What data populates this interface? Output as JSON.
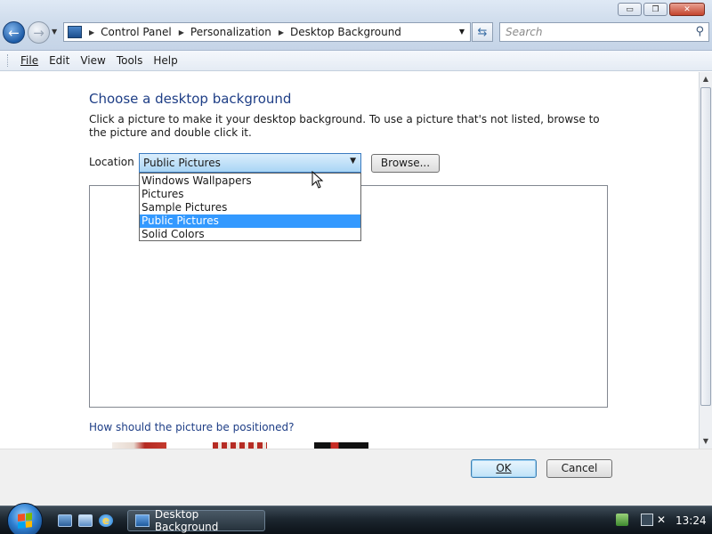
{
  "window": {
    "minimize_glyph": "▭",
    "maximize_glyph": "❐",
    "close_glyph": "✕"
  },
  "nav": {
    "back_glyph": "←",
    "forward_glyph": "→"
  },
  "address": {
    "crumbs": [
      "Control Panel",
      "Personalization",
      "Desktop Background"
    ]
  },
  "search": {
    "placeholder": "Search"
  },
  "menu": {
    "file": "File",
    "edit": "Edit",
    "view": "View",
    "tools": "Tools",
    "help": "Help"
  },
  "page": {
    "heading": "Choose a desktop background",
    "description": "Click a picture to make it your desktop background. To use a picture that's not listed, browse to the picture and double click it.",
    "location_label": "Location",
    "location_value": "Public Pictures",
    "browse_label": "Browse...",
    "position_question": "How should the picture be positioned?"
  },
  "location_options": [
    {
      "label": "Windows Wallpapers",
      "selected": false
    },
    {
      "label": "Pictures",
      "selected": false
    },
    {
      "label": "Sample Pictures",
      "selected": false
    },
    {
      "label": "Public Pictures",
      "selected": true
    },
    {
      "label": "Solid Colors",
      "selected": false
    }
  ],
  "footer": {
    "ok_label": "OK",
    "cancel_label": "Cancel"
  },
  "taskbar": {
    "active_window": "Desktop Background",
    "clock": "13:24"
  },
  "colors": {
    "heading": "#1e3e86",
    "selection": "#3399ff",
    "taskbar": "#1d2730"
  }
}
